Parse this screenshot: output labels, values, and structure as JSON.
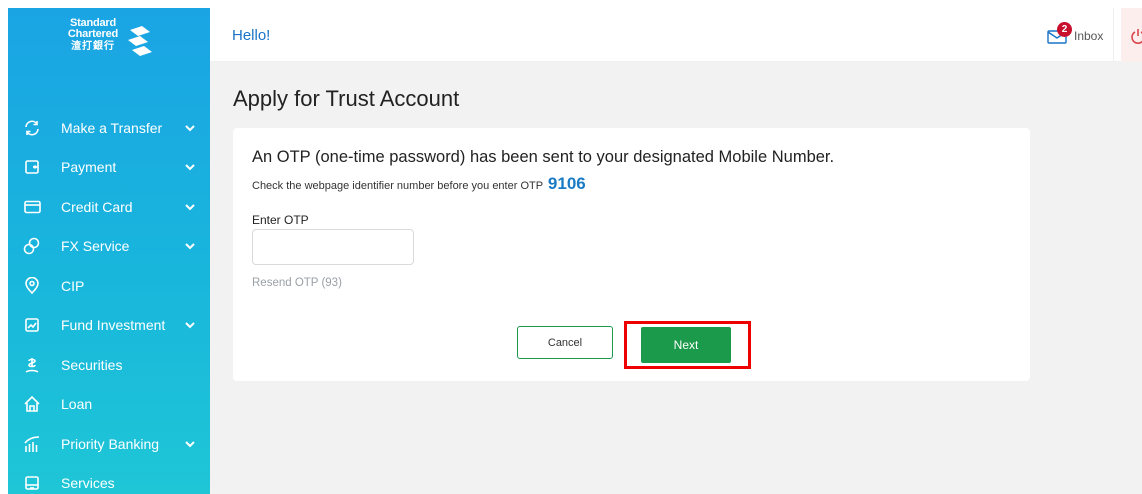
{
  "brand": {
    "line1": "Standard",
    "line2": "Chartered",
    "line3": "渣打銀行"
  },
  "sidebar": {
    "items": [
      {
        "label": "Make a Transfer",
        "icon": "transfer-icon",
        "expandable": true
      },
      {
        "label": "Payment",
        "icon": "wallet-icon",
        "expandable": true
      },
      {
        "label": "Credit Card",
        "icon": "credit-card-icon",
        "expandable": true
      },
      {
        "label": "FX Service",
        "icon": "fx-icon",
        "expandable": true
      },
      {
        "label": "CIP",
        "icon": "piggy-bank-icon",
        "expandable": false
      },
      {
        "label": "Fund Investment",
        "icon": "chart-icon",
        "expandable": true
      },
      {
        "label": "Securities",
        "icon": "securities-icon",
        "expandable": false
      },
      {
        "label": "Loan",
        "icon": "house-icon",
        "expandable": false
      },
      {
        "label": "Priority Banking",
        "icon": "priority-icon",
        "expandable": true
      },
      {
        "label": "Services",
        "icon": "services-icon",
        "expandable": false
      }
    ]
  },
  "header": {
    "greeting": "Hello!",
    "inbox_label": "Inbox",
    "inbox_count": "2"
  },
  "page": {
    "title": "Apply for Trust Account"
  },
  "otp": {
    "heading": "An OTP (one-time password) has been sent to your designated Mobile Number.",
    "identifier_text": "Check the webpage identifier number before you enter OTP",
    "identifier_code": "9106",
    "enter_label": "Enter OTP",
    "input_value": "",
    "resend_label": "Resend OTP (93)"
  },
  "actions": {
    "cancel_label": "Cancel",
    "next_label": "Next"
  },
  "colors": {
    "sidebar_top": "#1aa4e4",
    "sidebar_bottom": "#1ec6d6",
    "primary_green": "#1a9a4a",
    "link_blue": "#1a73c8",
    "highlight_red": "#ee0000"
  }
}
